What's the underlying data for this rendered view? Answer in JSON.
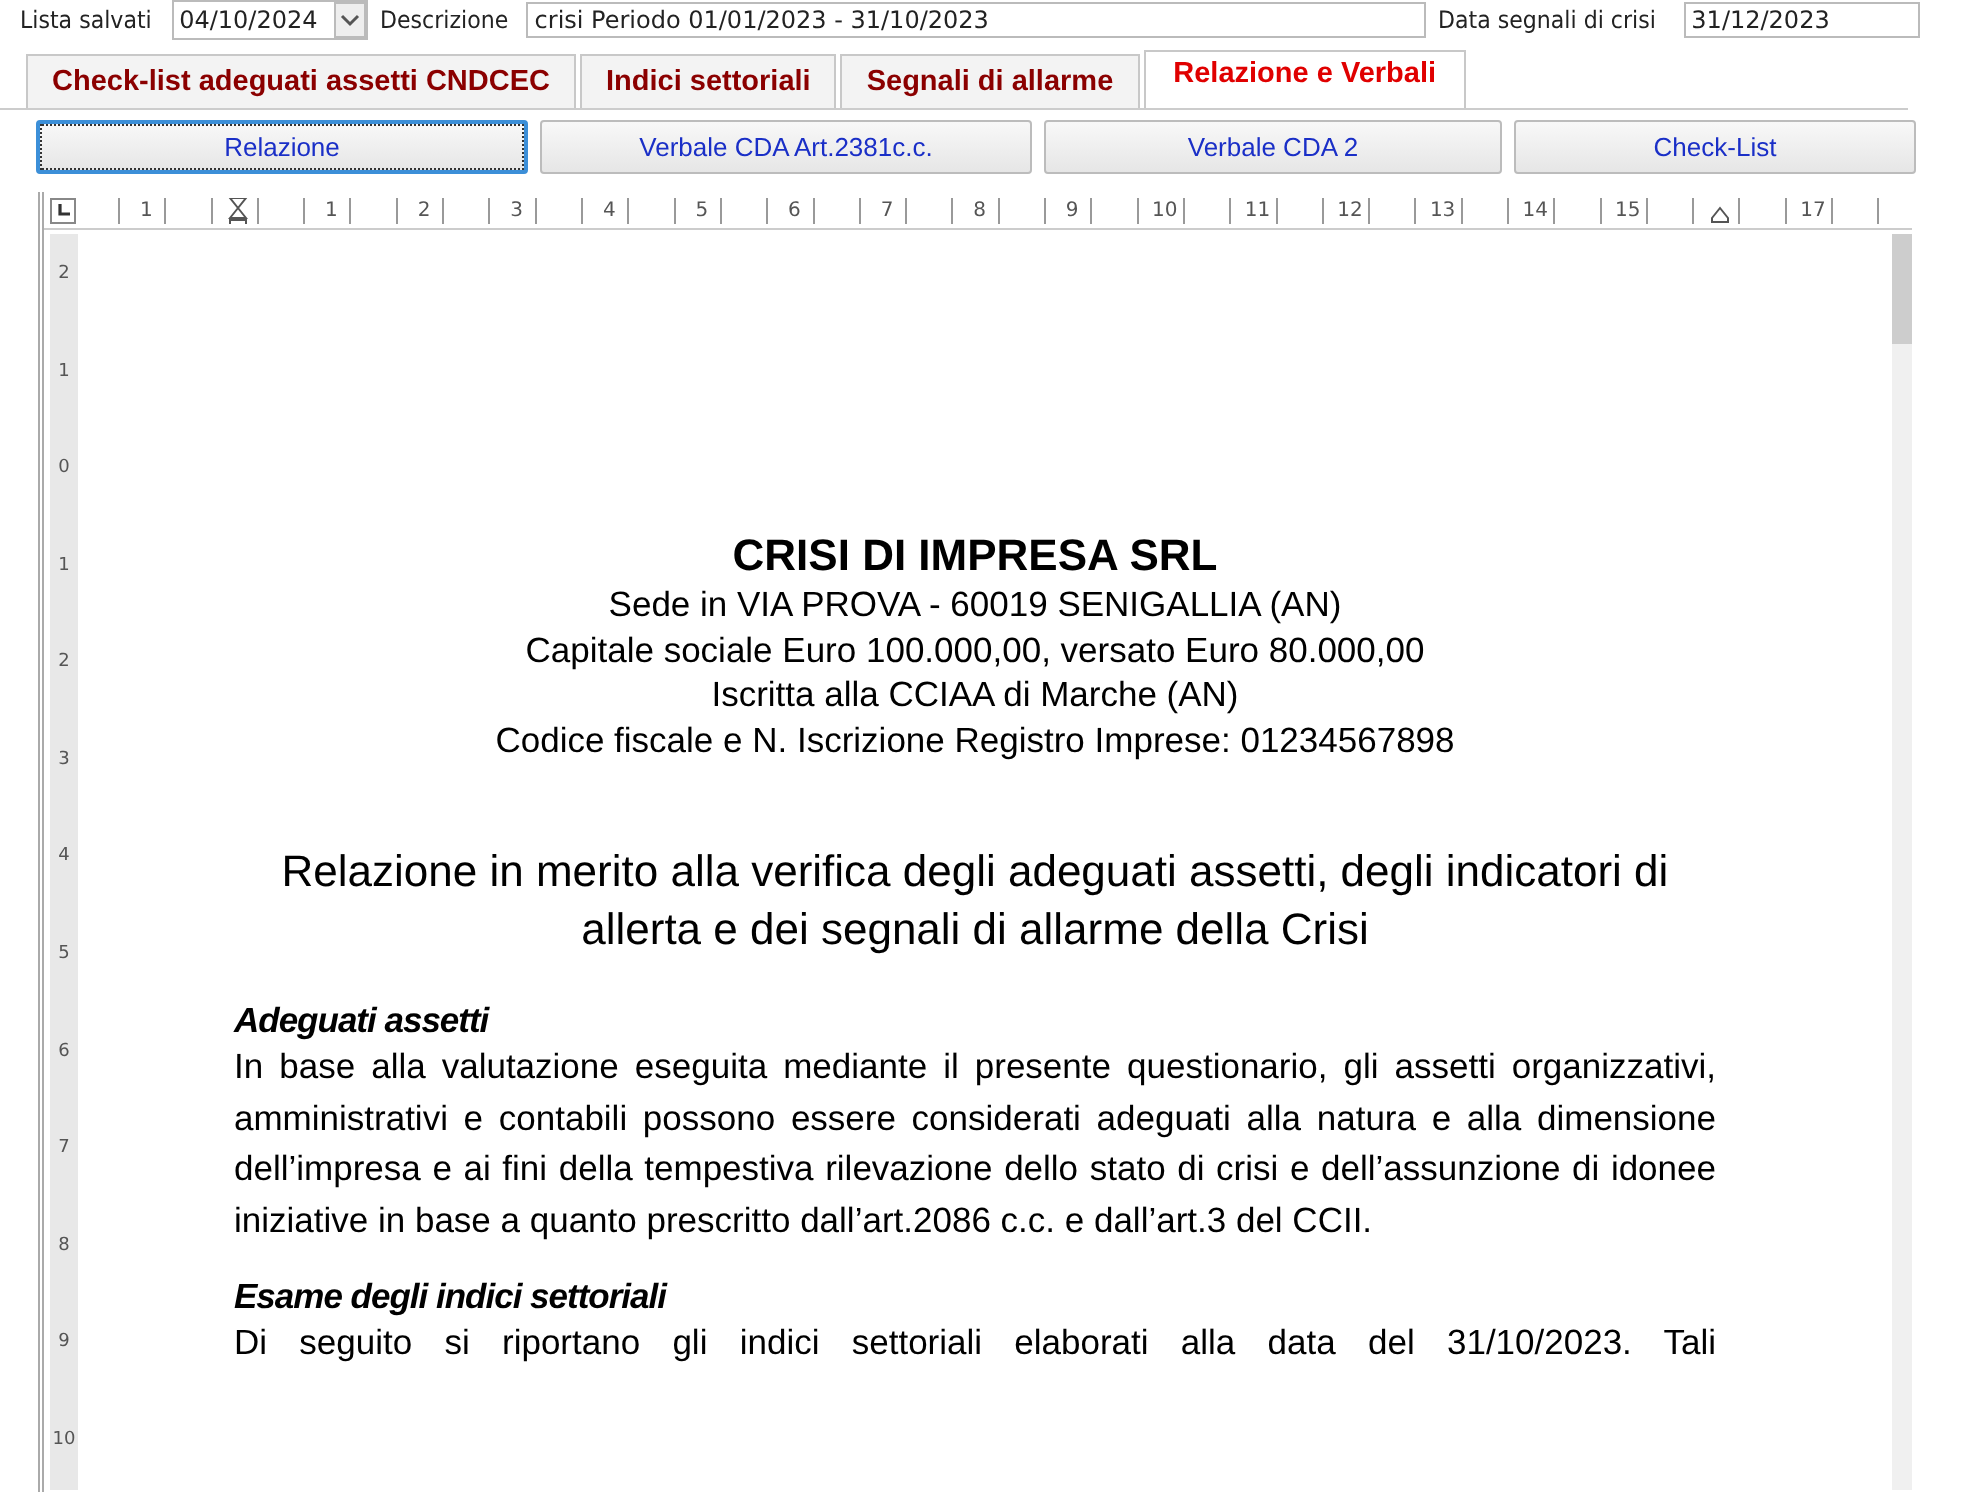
{
  "header": {
    "saved_list": {
      "label": "Lista salvati",
      "value": "04/10/2024"
    },
    "description": {
      "label": "Descrizione",
      "value": "crisi Periodo 01/01/2023 - 31/10/2023"
    },
    "crisis_date": {
      "label": "Data segnali di crisi",
      "value": "31/12/2023"
    }
  },
  "tabs": [
    {
      "label": "Check-list adeguati assetti CNDCEC",
      "selected": false
    },
    {
      "label": "Indici settoriali",
      "selected": false
    },
    {
      "label": "Segnali di allarme",
      "selected": false
    },
    {
      "label": "Relazione e Verbali",
      "selected": true
    }
  ],
  "buttons": [
    {
      "label": "Relazione",
      "selected": true
    },
    {
      "label": "Verbale CDA Art.2381c.c.",
      "selected": false
    },
    {
      "label": "Verbale CDA 2",
      "selected": false
    },
    {
      "label": "Check-List",
      "selected": false
    }
  ],
  "ruler": {
    "numbers": [
      "1",
      "1",
      "2",
      "3",
      "4",
      "5",
      "6",
      "7",
      "8",
      "9",
      "10",
      "11",
      "12",
      "13",
      "14",
      "15",
      "17"
    ],
    "vertical_numbers": [
      "2",
      "1",
      "0",
      "1",
      "2",
      "3",
      "4",
      "5",
      "6",
      "7",
      "8",
      "9",
      "10"
    ]
  },
  "document": {
    "company": "CRISI DI IMPRESA SRL",
    "company_lines": [
      "Sede in VIA PROVA - 60019 SENIGALLIA (AN)",
      "Capitale sociale Euro 100.000,00, versato Euro 80.000,00",
      "Iscritta alla CCIAA di Marche (AN)",
      "Codice fiscale e N. Iscrizione Registro Imprese: 01234567898"
    ],
    "title": "Relazione in merito alla verifica degli adeguati assetti, degli indicatori di allerta e dei segnali di allarme della Crisi",
    "sections": [
      {
        "heading": "Adeguati assetti",
        "text": "In base alla valutazione eseguita mediante il presente questionario, gli assetti organizzativi, amministrativi e contabili possono essere considerati adeguati alla natura e alla dimensione dell’impresa e ai fini della tempestiva rilevazione dello stato di crisi e dell’assunzione di idonee iniziative in base a quanto prescritto dall’art.2086 c.c. e dall’art.3 del CCII."
      },
      {
        "heading": "Esame degli indici settoriali",
        "text": "Di seguito si riportano gli indici settoriali elaborati alla data del 31/10/2023. Tali"
      }
    ]
  }
}
